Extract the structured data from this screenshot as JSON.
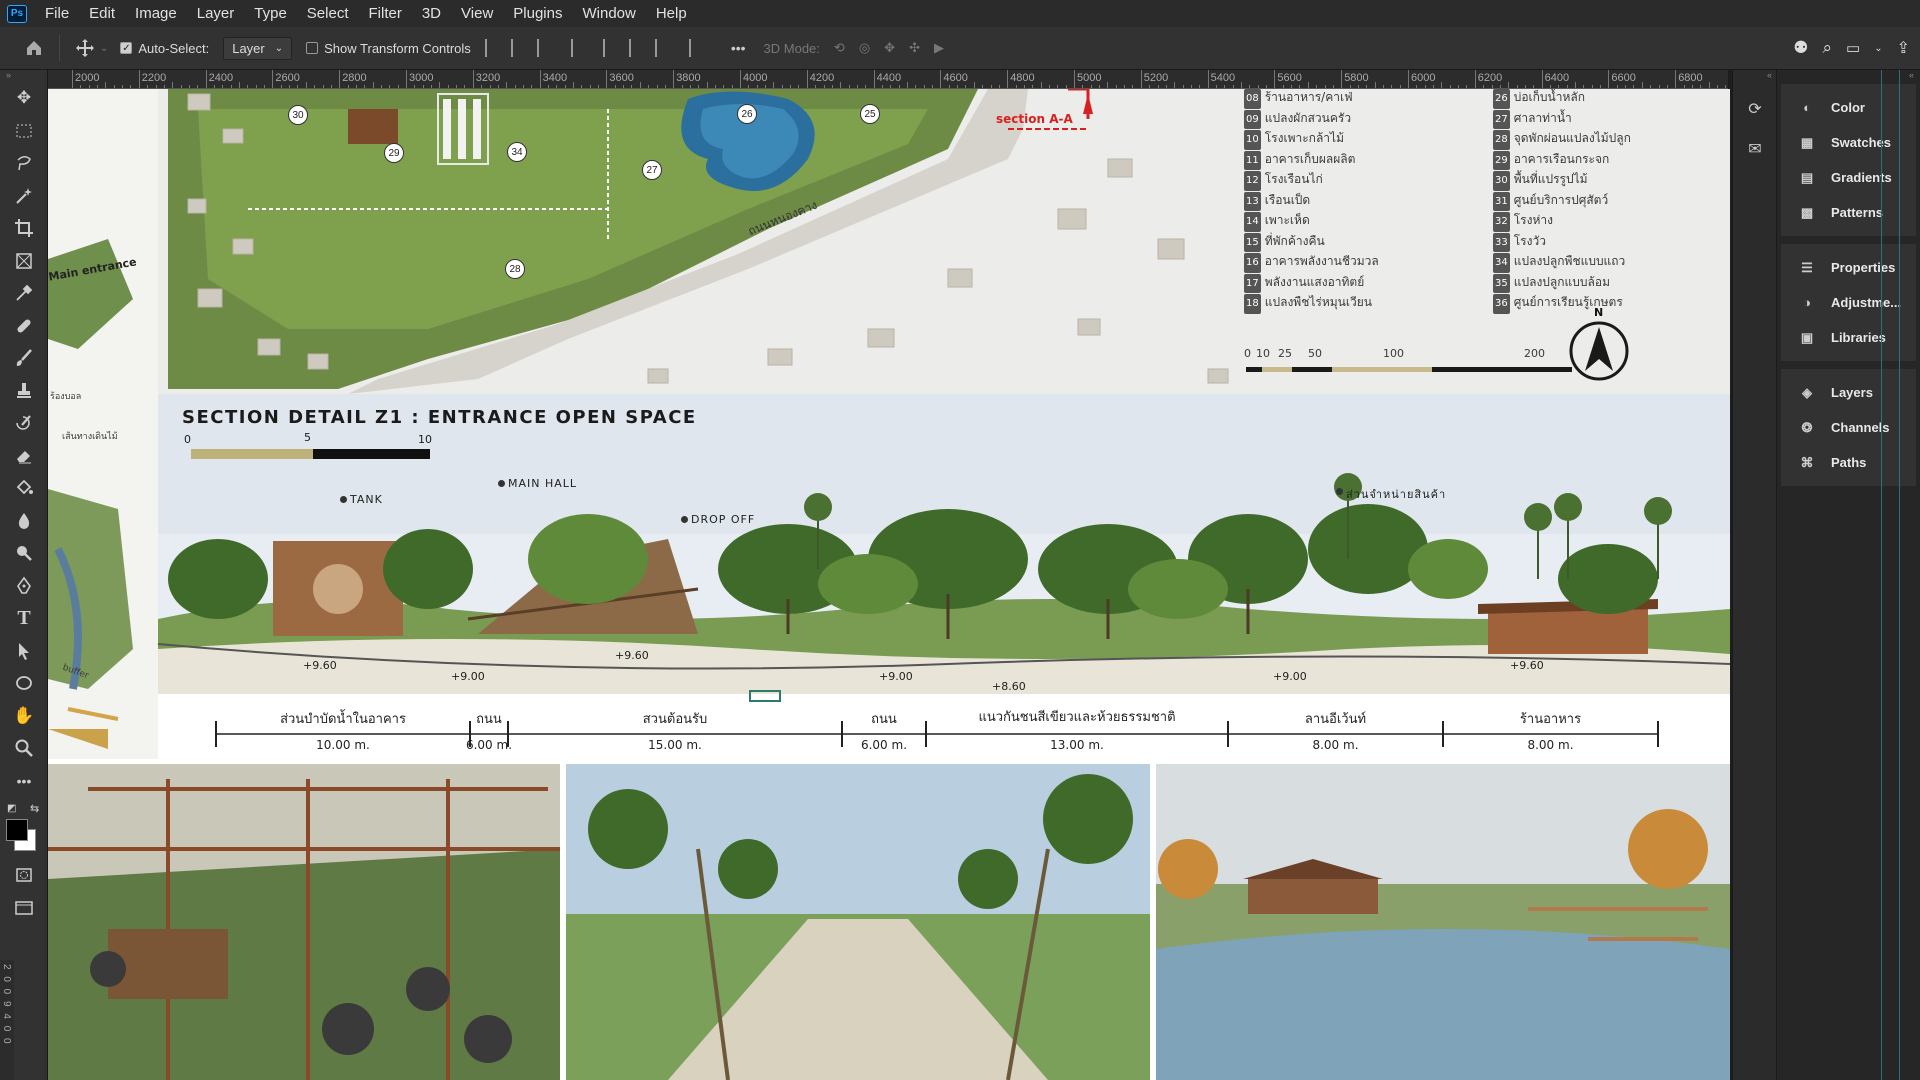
{
  "menu": {
    "logo": "Ps",
    "items": [
      "File",
      "Edit",
      "Image",
      "Layer",
      "Type",
      "Select",
      "Filter",
      "3D",
      "View",
      "Plugins",
      "Window",
      "Help"
    ]
  },
  "options": {
    "auto_select_label": "Auto-Select:",
    "auto_select_target": "Layer",
    "show_transform_label": "Show Transform Controls",
    "mode_3d_label": "3D Mode:",
    "more_label": "•••"
  },
  "ruler": {
    "labels": [
      "2000",
      "2200",
      "2400",
      "2600",
      "2800",
      "3000",
      "3200",
      "3400",
      "3600",
      "3800",
      "4000",
      "4200",
      "4400",
      "4600",
      "4800",
      "5000",
      "5200",
      "5400",
      "5600",
      "5800",
      "6000",
      "6200",
      "6400",
      "6600",
      "6800"
    ],
    "vertical_labels": "2 0 0 9 4 0 0"
  },
  "panels": {
    "group1": [
      "Color",
      "Swatches",
      "Gradients",
      "Patterns"
    ],
    "group2": [
      "Properties",
      "Adjustme...",
      "Libraries"
    ],
    "group3": [
      "Layers",
      "Channels",
      "Paths"
    ],
    "icons1": [
      "color-icon",
      "swatches-icon",
      "gradients-icon",
      "patterns-icon"
    ],
    "icons2": [
      "properties-icon",
      "adjustments-icon",
      "libraries-icon"
    ],
    "icons3": [
      "layers-icon",
      "channels-icon",
      "paths-icon"
    ]
  },
  "document": {
    "map": {
      "section_label": "section A-A",
      "road_label": "ถนนหนองคาง",
      "entrance_label": "Main entrance",
      "left_labels": [
        "เส้นทางเดินไม้",
        "ร้องบอล",
        "buffer"
      ],
      "markers": [
        "30",
        "29",
        "34",
        "28",
        "26",
        "25",
        "27"
      ],
      "legend_left": [
        {
          "num": "08",
          "text": "ร้านอาหาร/คาเฟ่"
        },
        {
          "num": "09",
          "text": "แปลงผักสวนครัว"
        },
        {
          "num": "10",
          "text": "โรงเพาะกล้าไม้"
        },
        {
          "num": "11",
          "text": "อาคารเก็บผลผลิต"
        },
        {
          "num": "12",
          "text": "โรงเรือนไก่"
        },
        {
          "num": "13",
          "text": "เรือนเป็ด"
        },
        {
          "num": "14",
          "text": "เพาะเห็ด"
        },
        {
          "num": "15",
          "text": "ที่พักค้างคืน"
        },
        {
          "num": "16",
          "text": "อาคารพลังงานชีวมวล"
        },
        {
          "num": "17",
          "text": "พลังงานแสงอาทิตย์"
        },
        {
          "num": "18",
          "text": "แปลงพืชไร่หมุนเวียน"
        }
      ],
      "legend_right": [
        {
          "num": "26",
          "text": "บ่อเก็บน้ำหลัก"
        },
        {
          "num": "27",
          "text": "ศาลาท่าน้ำ"
        },
        {
          "num": "28",
          "text": "จุดพักผ่อนแปลงไม้ปลูก"
        },
        {
          "num": "29",
          "text": "อาคารเรือนกระจก"
        },
        {
          "num": "30",
          "text": "พื้นที่แปรรูปไม้"
        },
        {
          "num": "31",
          "text": "ศูนย์บริการปศุสัตว์"
        },
        {
          "num": "32",
          "text": "โรงห่าง"
        },
        {
          "num": "33",
          "text": "โรงวัว"
        },
        {
          "num": "34",
          "text": "แปลงปลูกพืชแบบแถว"
        },
        {
          "num": "35",
          "text": "แปลงปลูกแบบล้อม"
        },
        {
          "num": "36",
          "text": "ศูนย์การเรียนรู้เกษตร"
        }
      ],
      "scale_labels": [
        "0",
        "10",
        "25",
        "50",
        "100",
        "200"
      ],
      "north": "N"
    },
    "section": {
      "title": "SECTION DETAIL Z1 : ENTRANCE OPEN SPACE",
      "scale_labels": [
        "0",
        "5",
        "10"
      ],
      "callouts": [
        "TANK",
        "MAIN HALL",
        "DROP OFF",
        "ส่วนจำหน่ายสินค้า"
      ],
      "elevations": [
        "+9.60",
        "+9.00",
        "+9.60",
        "+9.00",
        "+8.60",
        "+9.00",
        "+9.60"
      ],
      "zones": [
        {
          "label": "ส่วนบำบัดน้ำในอาคาร",
          "dist": "10.00 m."
        },
        {
          "label": "ถนน",
          "dist": "6.00 m."
        },
        {
          "label": "สวนต้อนรับ",
          "dist": "15.00 m."
        },
        {
          "label": "ถนน",
          "dist": "6.00 m."
        },
        {
          "label": "แนวกันชนสีเขียวและห้วยธรรมชาติ",
          "dist": "13.00 m."
        },
        {
          "label": "ลานอีเว้นท์",
          "dist": "8.00 m."
        },
        {
          "label": "ร้านอาหาร",
          "dist": "8.00 m."
        }
      ]
    }
  },
  "colors": {
    "accent": "#31a8ff",
    "map_green": "#5b8a3a",
    "water": "#2b6f9e",
    "section_red": "#d92020"
  }
}
